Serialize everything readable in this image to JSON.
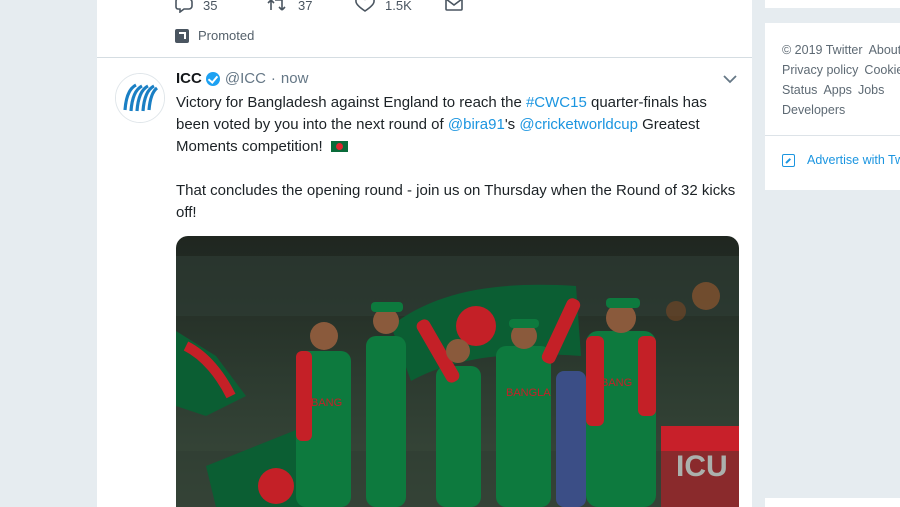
{
  "prev_tweet_actions": {
    "reply_count": "35",
    "retweet_count": "37",
    "like_count": "1.5K"
  },
  "promoted_label": "Promoted",
  "tweet": {
    "name": "ICC",
    "handle": "@ICC",
    "separator": "·",
    "time": "now",
    "text": {
      "p1_a": "Victory for Bangladesh against England to reach the ",
      "hashtag": "#CWC15",
      "p1_b": " quarter-finals has been voted by you into the next round of ",
      "mention1": "@bira91",
      "p1_c": "'s ",
      "mention2": "@cricketworldcup",
      "p1_d": " Greatest Moments competition! ",
      "p2": "That concludes the opening round - join us on Thursday when the Round of 32 kicks off!"
    }
  },
  "sidebar": {
    "footer_links": [
      "© 2019 Twitter",
      "About",
      "Privacy policy",
      "Cookies",
      "Status",
      "Apps",
      "Jobs",
      "Developers"
    ],
    "advertise_label": "Advertise with Twitter"
  },
  "colors": {
    "link": "#1b95e0",
    "verified": "#1da1f2",
    "background": "#e6ecf0"
  },
  "icons": [
    "reply-icon",
    "retweet-icon",
    "like-icon",
    "dm-icon",
    "promoted-icon",
    "verified-icon",
    "chevron-down-icon",
    "advertise-icon",
    "flag-bangladesh-icon"
  ]
}
